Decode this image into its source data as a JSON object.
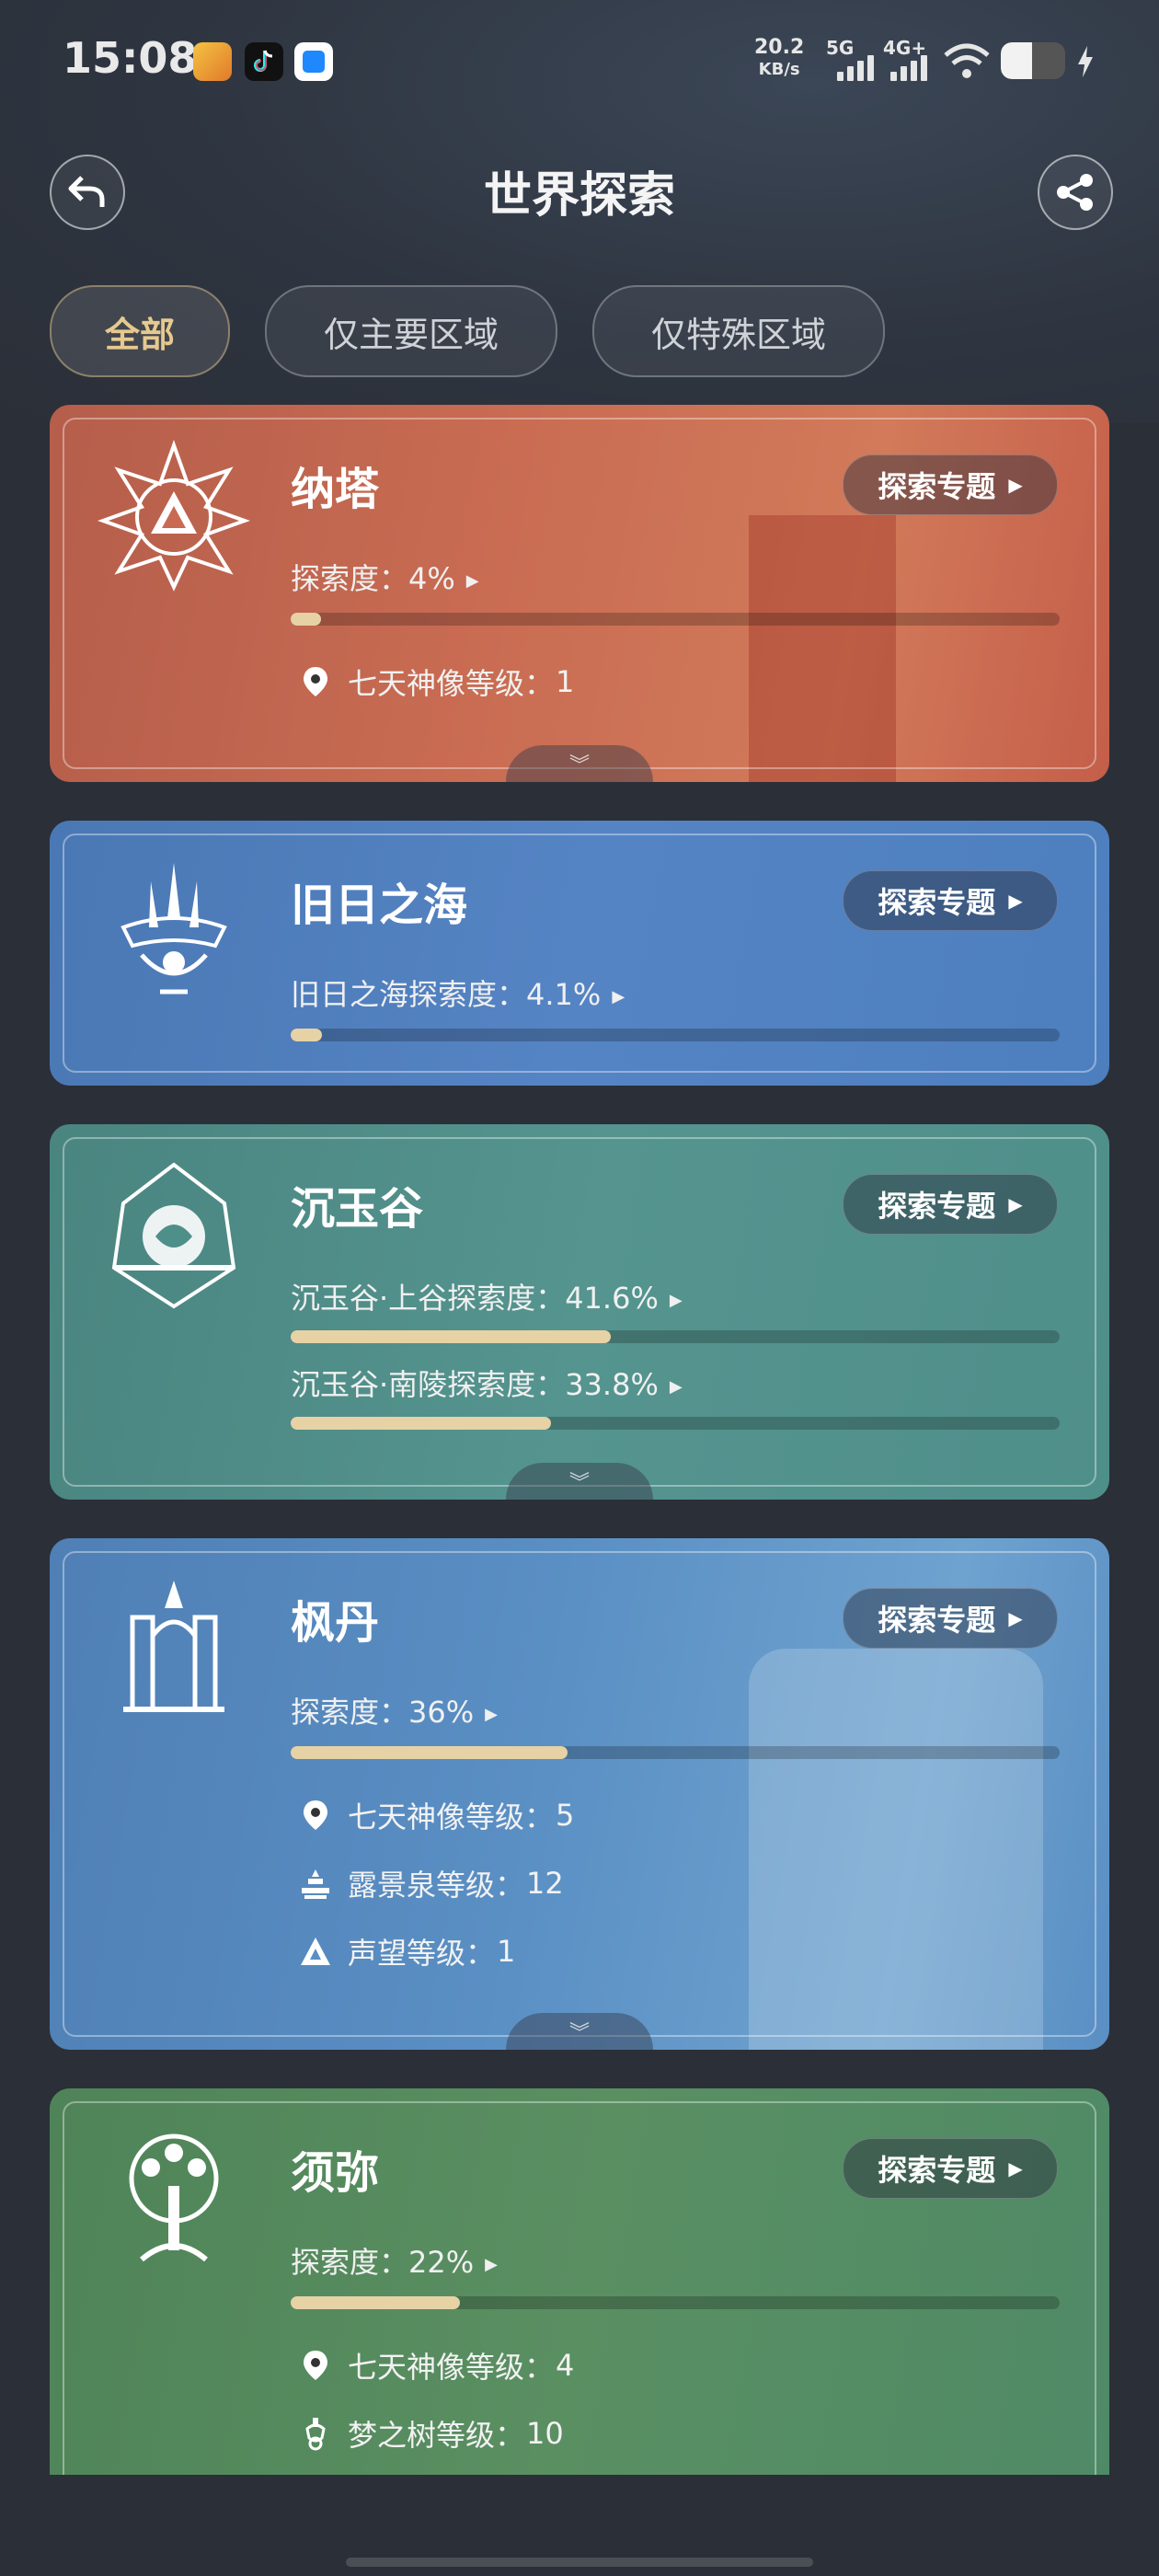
{
  "status_bar": {
    "time": "15:08",
    "net_speed_value": "20.2",
    "net_speed_unit": "KB/s",
    "signal_1": "5G",
    "signal_2": "4G+"
  },
  "header": {
    "title": "世界探索",
    "back_icon": "back-arrow-icon",
    "share_icon": "share-icon"
  },
  "tabs": [
    {
      "label": "全部",
      "active": true
    },
    {
      "label": "仅主要区域",
      "active": false
    },
    {
      "label": "仅特殊区域",
      "active": false
    }
  ],
  "colors": {
    "accent_gold": "#e7c98f",
    "progress_fill": "#e6d2a5",
    "natlan": "#c86b52",
    "sea": "#4d7fbf",
    "chenyu": "#4f8f8a",
    "fontaine": "#5a8fc4",
    "sumeru": "#5a8f62"
  },
  "cards": [
    {
      "name": "纳塔",
      "topic_button": "探索专题",
      "explorations": [
        {
          "label": "探索度：",
          "value": "4%",
          "progress": 0.04
        }
      ],
      "stats": [
        {
          "icon": "statue-pin-icon",
          "label": "七天神像等级：",
          "value": "1"
        }
      ]
    },
    {
      "name": "旧日之海",
      "topic_button": "探索专题",
      "explorations": [
        {
          "label": "旧日之海探索度：",
          "value": "4.1%",
          "progress": 0.041
        }
      ],
      "stats": []
    },
    {
      "name": "沉玉谷",
      "topic_button": "探索专题",
      "explorations": [
        {
          "label": "沉玉谷·上谷探索度：",
          "value": "41.6%",
          "progress": 0.416
        },
        {
          "label": "沉玉谷·南陵探索度：",
          "value": "33.8%",
          "progress": 0.338
        }
      ],
      "stats": []
    },
    {
      "name": "枫丹",
      "topic_button": "探索专题",
      "explorations": [
        {
          "label": "探索度：",
          "value": "36%",
          "progress": 0.36
        }
      ],
      "stats": [
        {
          "icon": "statue-pin-icon",
          "label": "七天神像等级：",
          "value": "5"
        },
        {
          "icon": "fountain-icon",
          "label": "露景泉等级：",
          "value": "12"
        },
        {
          "icon": "reputation-icon",
          "label": "声望等级：",
          "value": "1"
        }
      ]
    },
    {
      "name": "须弥",
      "topic_button": "探索专题",
      "explorations": [
        {
          "label": "探索度：",
          "value": "22%",
          "progress": 0.22
        }
      ],
      "stats": [
        {
          "icon": "statue-pin-icon",
          "label": "七天神像等级：",
          "value": "4"
        },
        {
          "icon": "dream-tree-icon",
          "label": "梦之树等级：",
          "value": "10"
        }
      ]
    }
  ]
}
